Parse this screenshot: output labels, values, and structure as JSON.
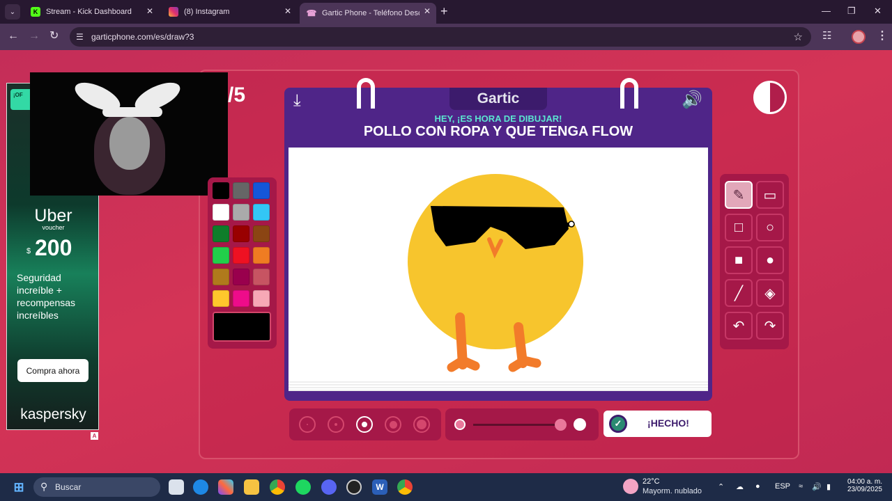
{
  "browser": {
    "tabs": [
      {
        "title": "Stream - Kick Dashboard",
        "icon": "kick-icon"
      },
      {
        "title": "(8) Instagram",
        "icon": "instagram-icon"
      },
      {
        "title": "Gartic Phone - Teléfono Descon",
        "icon": "phone-icon"
      }
    ],
    "url": "garticphone.com/es/draw?3"
  },
  "game": {
    "round": "/5",
    "logo": "Gartic",
    "prompt_header": "HEY, ¡ES HORA DE DIBUJAR!",
    "phrase": "POLLO CON ROPA Y QUE TENGA FLOW",
    "done_label": "¡HECHO!",
    "selected_color": "#000000",
    "selected_tool": "pen",
    "palette": [
      "#000000",
      "#666666",
      "#1556d9",
      "#ffffff",
      "#aaaaaa",
      "#33c6f5",
      "#0f7d2a",
      "#990000",
      "#8b4513",
      "#22cf4a",
      "#ee1122",
      "#ef7c22",
      "#b07a1c",
      "#99004d",
      "#c75462",
      "#ffc72c",
      "#ee0c8a",
      "#f7a8b6"
    ],
    "tools": [
      "pen",
      "eraser",
      "rectangle",
      "ellipse",
      "filled-rectangle",
      "filled-ellipse",
      "line",
      "fill",
      "undo",
      "redo"
    ],
    "brush_sizes": 5,
    "selected_size": 3
  },
  "ad": {
    "promo": "¡OF",
    "brand_line": "Uber",
    "voucher": "voucher",
    "currency": "$",
    "amount": "200",
    "text": "Seguridad increíble + recompensas increíbles",
    "button": "Compra ahora",
    "brand": "kaspersky",
    "adchoice": "A"
  },
  "taskbar": {
    "search_label": "Buscar",
    "weather_temp": "22°C",
    "weather_desc": "Mayorm. nublado",
    "lang": "ESP",
    "time": "04:00 a. m.",
    "date": "23/09/2025"
  }
}
